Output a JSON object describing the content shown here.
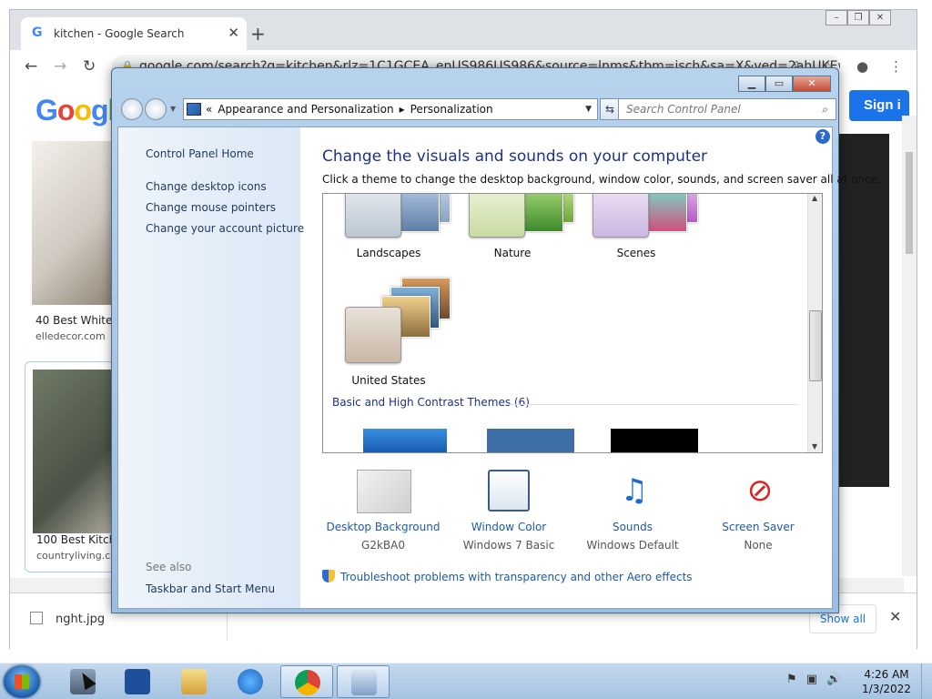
{
  "chrome": {
    "tab_title": "kitchen - Google Search",
    "url": "google.com/search?q=kitchen&rlz=1C1GCEA_enUS986US986&source=lnms&tbm=isch&sa=X&ved=2ahUKEwi",
    "sign_in": "Sign i",
    "google_logo": "Google",
    "results": [
      {
        "caption": "40 Best White K",
        "source": "elledecor.com"
      },
      {
        "caption": "100 Best Kitche",
        "source": "countryliving.co"
      }
    ],
    "download": {
      "file": "nght.jpg",
      "show_all": "Show all"
    }
  },
  "cp": {
    "address": [
      "«",
      "Appearance and Personalization",
      "▸",
      "Personalization"
    ],
    "search_placeholder": "Search Control Panel",
    "nav": {
      "home": "Control Panel Home",
      "links": [
        "Change desktop icons",
        "Change mouse pointers",
        "Change your account picture"
      ],
      "see_also": "See also",
      "taskbar": "Taskbar and Start Menu"
    },
    "heading": "Change the visuals and sounds on your computer",
    "subheading": "Click a theme to change the desktop background, window color, sounds, and screen saver all at once.",
    "themes": [
      "Landscapes",
      "Nature",
      "Scenes",
      "United States"
    ],
    "basic_group": "Basic and High Contrast Themes (6)",
    "bottom": [
      {
        "name": "Desktop Background",
        "value": "G2kBA0"
      },
      {
        "name": "Window Color",
        "value": "Windows 7 Basic"
      },
      {
        "name": "Sounds",
        "value": "Windows Default"
      },
      {
        "name": "Screen Saver",
        "value": "None"
      }
    ],
    "troubleshoot": "Troubleshoot problems with transparency and other Aero effects"
  },
  "taskbar": {
    "time": "4:26 AM",
    "date": "1/3/2022"
  }
}
